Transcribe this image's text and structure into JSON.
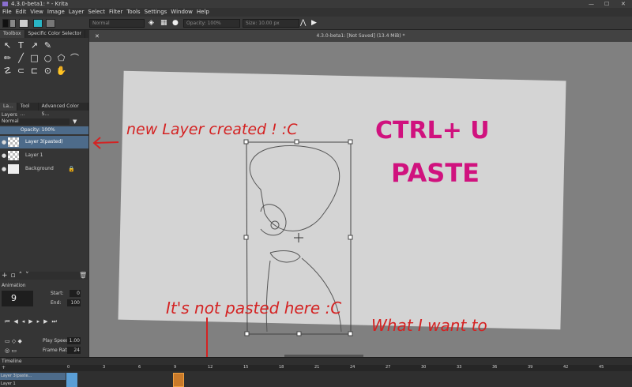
{
  "window": {
    "title": "4.3.0-beta1: * - Krita",
    "controls": [
      "—",
      "☐",
      "✕"
    ]
  },
  "menu": [
    "File",
    "Edit",
    "View",
    "Image",
    "Layer",
    "Select",
    "Filter",
    "Tools",
    "Settings",
    "Window",
    "Help"
  ],
  "toolbar": {
    "blend_mode": "Normal",
    "opacity": "Opacity: 100%",
    "size": "Size: 10.00 px"
  },
  "toolbox": {
    "tabs": [
      "Toolbox",
      "Specific Color Selector"
    ]
  },
  "layers_docker": {
    "tabs": [
      "La...",
      "Tool ...",
      "Advanced Color S..."
    ],
    "title": "Layers",
    "blend": "Normal",
    "opacity": "Opacity: 100%",
    "layers": [
      {
        "name": "Layer 3(pasted)",
        "selected": true
      },
      {
        "name": "Layer 1",
        "selected": false
      },
      {
        "name": "Background",
        "selected": false
      }
    ]
  },
  "document": {
    "tab": "4.3.0-beta1: [Not Saved] (13.4 MiB) *"
  },
  "animation": {
    "title": "Animation",
    "frame": "9",
    "start_label": "Start:",
    "start": "0",
    "end_label": "End:",
    "end": "100",
    "play_speed_label": "Play Speed:",
    "play_speed": "1.00",
    "frame_rate_label": "Frame Rate:",
    "frame_rate": "24"
  },
  "timeline": {
    "title": "Timeline",
    "ticks": [
      "0",
      "3",
      "6",
      "9",
      "12",
      "15",
      "18",
      "21",
      "24",
      "27",
      "30",
      "33",
      "36",
      "39",
      "42",
      "45"
    ],
    "rows": [
      "Layer 3(paste...",
      "Layer 1"
    ]
  },
  "annotations": {
    "new_layer": "new Layer created ! :C",
    "shortcut": "CTRL+ U",
    "paste": "PASTE",
    "not_pasted": "It's not pasted here :C",
    "want": "What I want to"
  },
  "colors": {
    "annotation_red": "#d42222",
    "annotation_magenta": "#d0127e",
    "selection": "#4d6b8a"
  }
}
